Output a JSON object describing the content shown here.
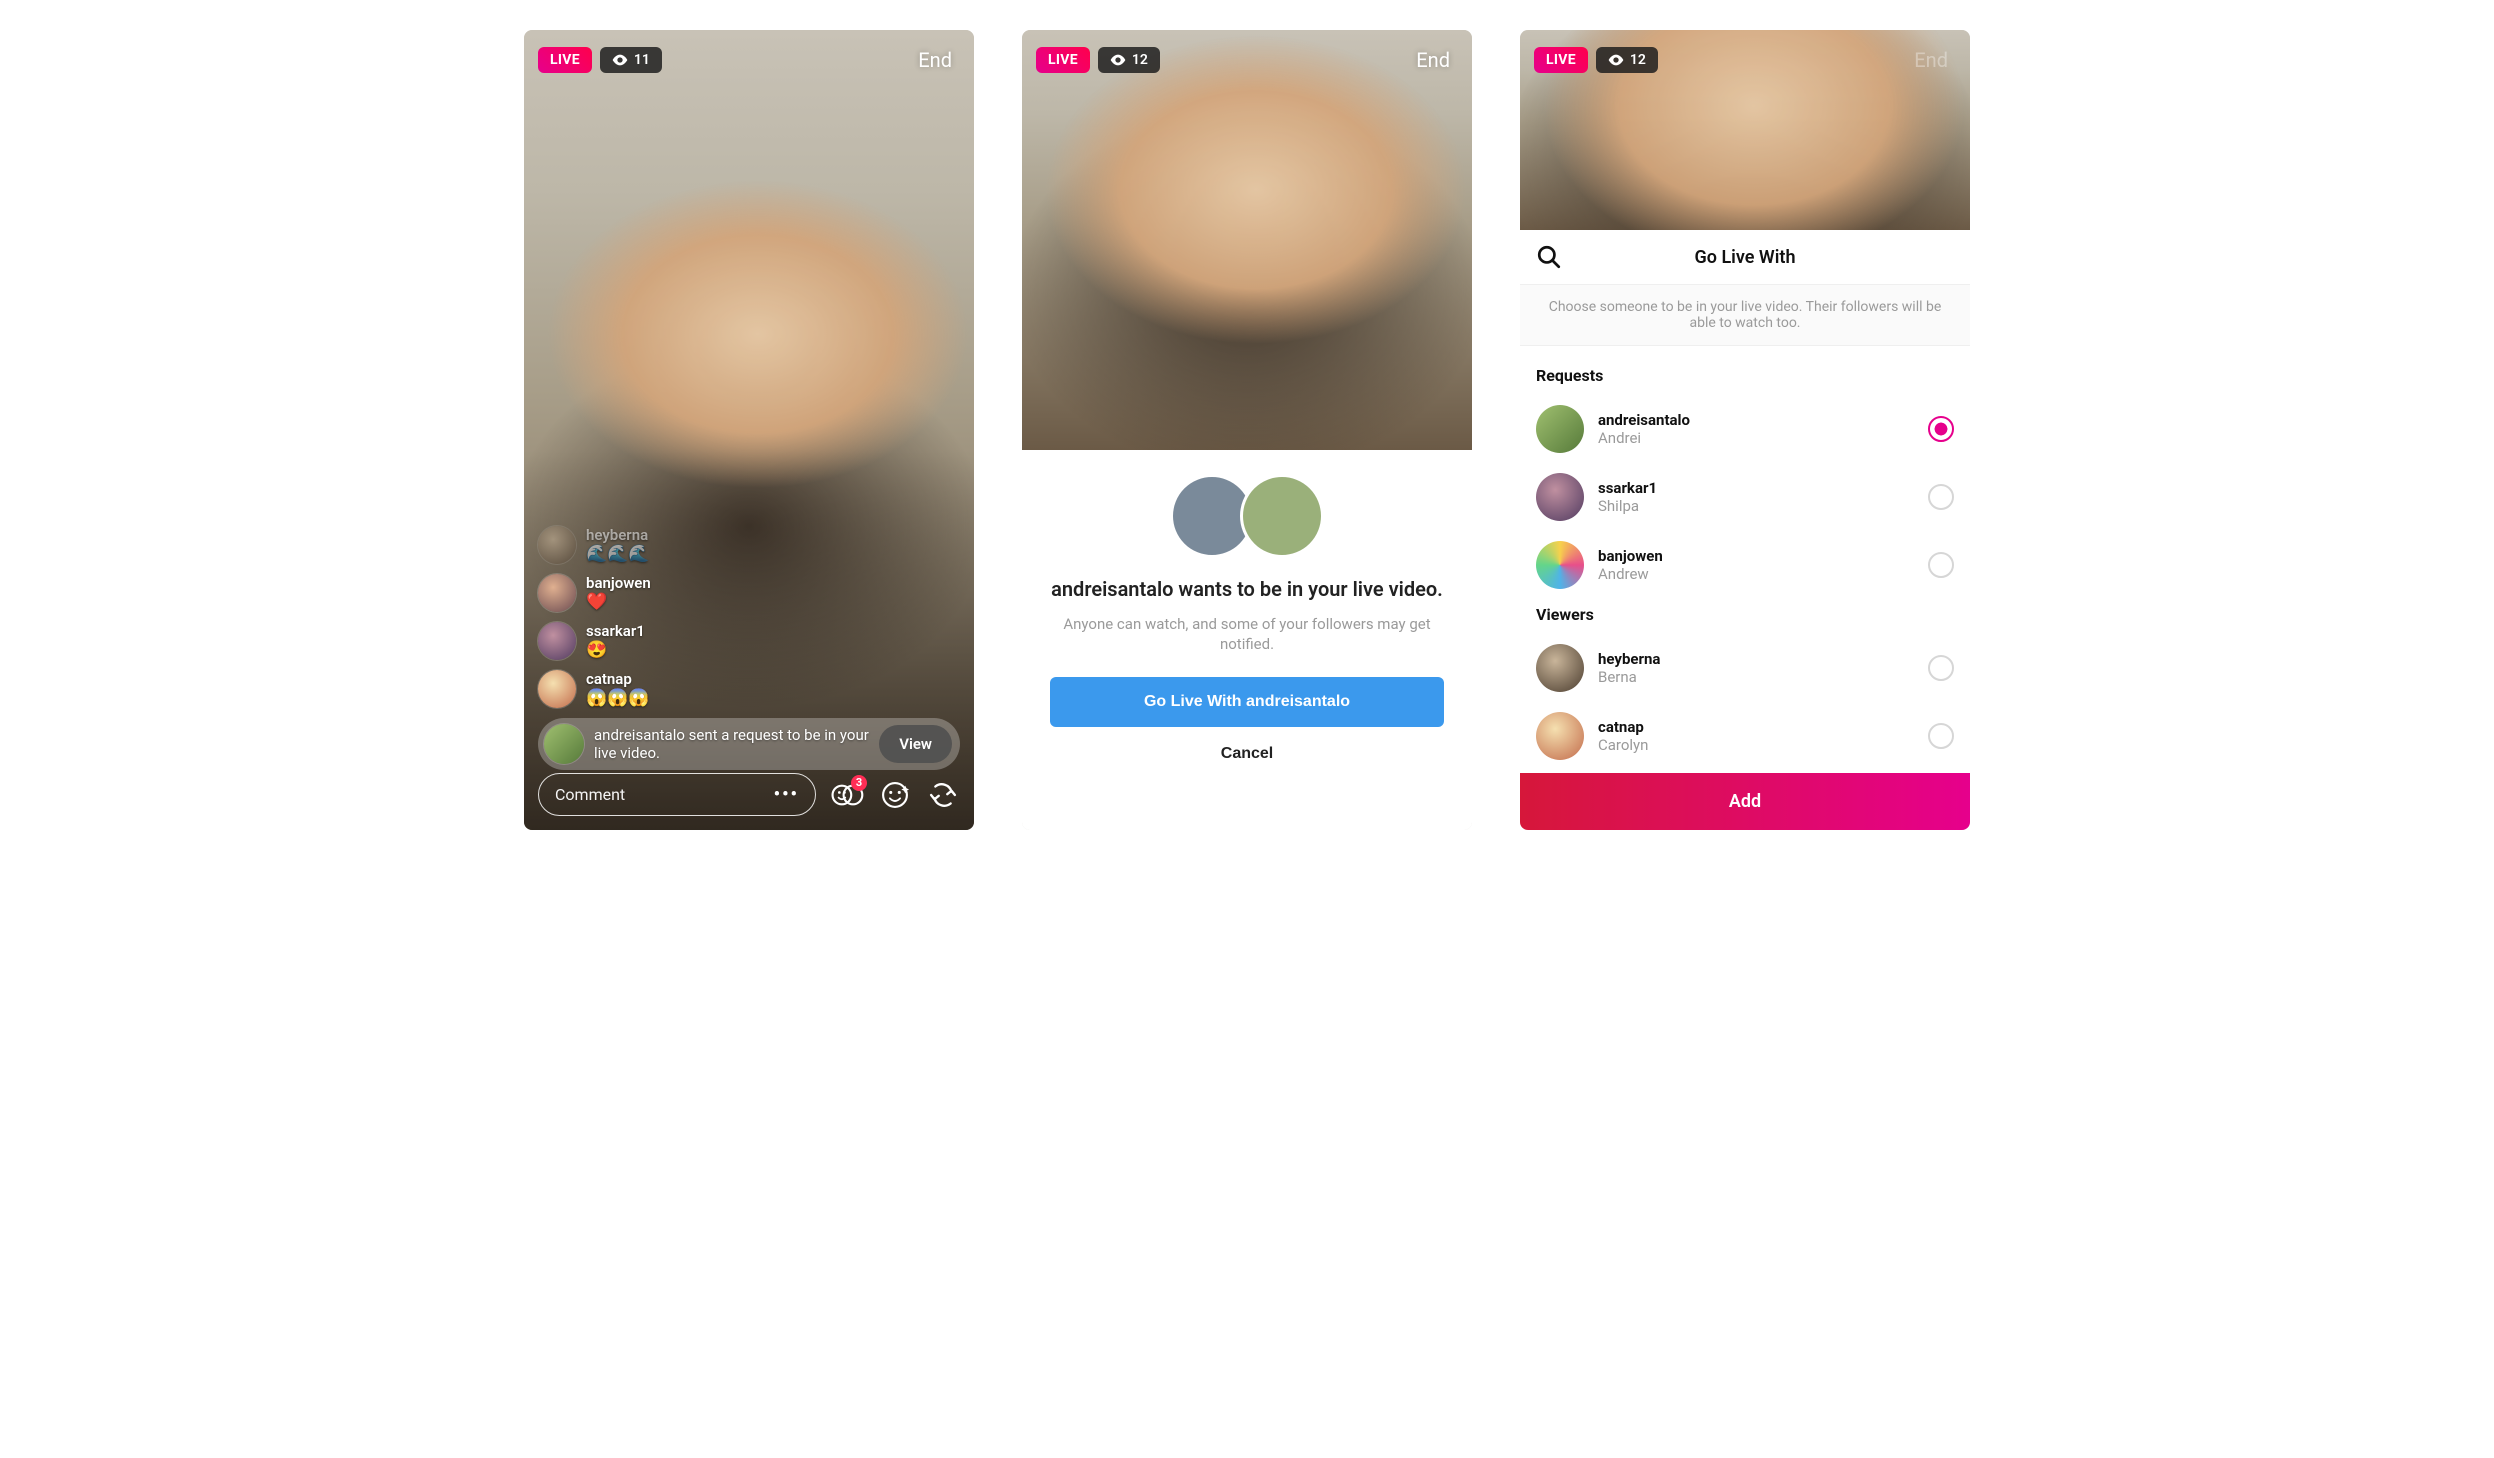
{
  "s1": {
    "live": "LIVE",
    "viewers": "11",
    "end": "End",
    "comments": [
      {
        "user": "heyberna",
        "body": "🌊🌊🌊"
      },
      {
        "user": "banjowen",
        "body": "❤️"
      },
      {
        "user": "ssarkar1",
        "body": "😍"
      },
      {
        "user": "catnap",
        "body": "😱😱😱"
      }
    ],
    "request": "andreisantalo sent a request to be in your live video.",
    "view": "View",
    "commentPlaceholder": "Comment",
    "badgeCount": "3"
  },
  "s2": {
    "live": "LIVE",
    "viewers": "12",
    "end": "End",
    "title": "andreisantalo wants to be in your live video.",
    "sub": "Anyone can watch, and some of your followers may get notified.",
    "primary": "Go Live With andreisantalo",
    "cancel": "Cancel"
  },
  "s3": {
    "live": "LIVE",
    "viewers": "12",
    "end": "End",
    "title": "Go Live With",
    "helper": "Choose someone to be in your live video. Their followers will be able to watch too.",
    "requestsHeader": "Requests",
    "viewersHeader": "Viewers",
    "requests": [
      {
        "username": "andreisantalo",
        "name": "Andrei",
        "selected": true
      },
      {
        "username": "ssarkar1",
        "name": "Shilpa",
        "selected": false
      },
      {
        "username": "banjowen",
        "name": "Andrew",
        "selected": false
      }
    ],
    "viewersList": [
      {
        "username": "heyberna",
        "name": "Berna"
      },
      {
        "username": "catnap",
        "name": "Carolyn"
      }
    ],
    "add": "Add"
  }
}
